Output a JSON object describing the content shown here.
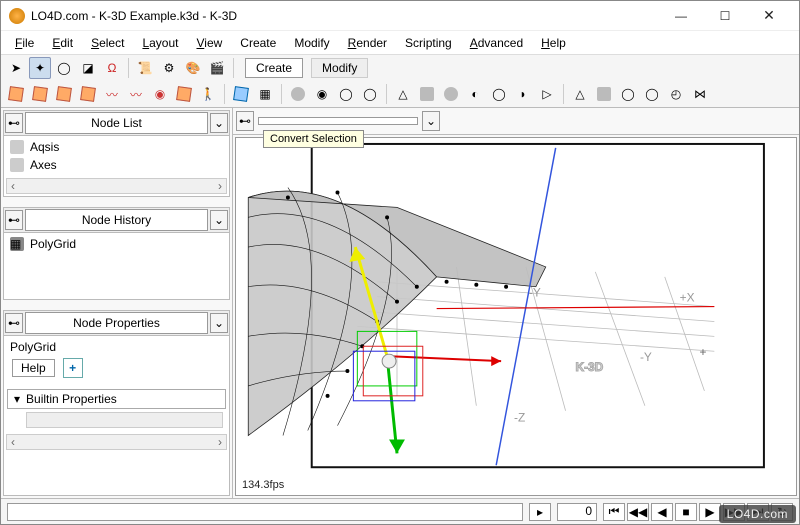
{
  "window": {
    "title": "LO4D.com - K-3D Example.k3d - K-3D"
  },
  "menu": {
    "file": "File",
    "edit": "Edit",
    "select": "Select",
    "layout": "Layout",
    "view": "View",
    "create": "Create",
    "modify": "Modify",
    "render": "Render",
    "scripting": "Scripting",
    "advanced": "Advanced",
    "help": "Help"
  },
  "toolbar": {
    "tabs": {
      "create": "Create",
      "modify": "Modify"
    },
    "tooltip": "Convert Selection"
  },
  "sidebar": {
    "node_list": {
      "title": "Node List",
      "items": [
        "Aqsis",
        "Axes"
      ]
    },
    "node_history": {
      "title": "Node History",
      "items": [
        "PolyGrid"
      ]
    },
    "node_props": {
      "title": "Node Properties",
      "object": "PolyGrid",
      "help": "Help",
      "sections": {
        "builtin": "Builtin Properties"
      }
    }
  },
  "viewport": {
    "fps": "134.3fps",
    "axis_labels": {
      "px": "+X",
      "my": "-Y",
      "mz": "-Z",
      "myy": "-Y"
    },
    "logo_text": "K-3D"
  },
  "status": {
    "frame": "0"
  },
  "watermark": "LO4D.com"
}
